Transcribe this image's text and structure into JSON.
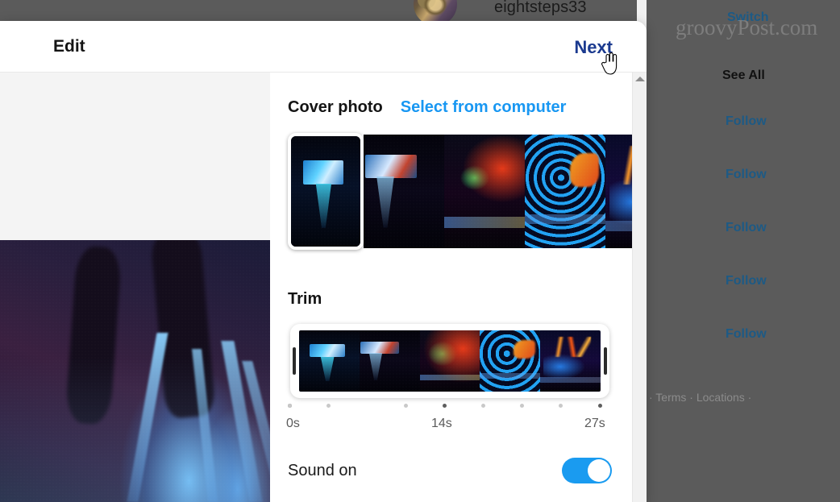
{
  "backdrop": {
    "username": "eightsteps33",
    "switch_label": "Switch",
    "watermark": "groovyPost.com",
    "see_all_label": "See All",
    "follow_labels": [
      "Follow",
      "Follow",
      "Follow",
      "Follow",
      "Follow"
    ],
    "footer_text": "· Terms · Locations ·",
    "dim_color": "#5b5b5b",
    "link_color": "#1d5a85"
  },
  "modal": {
    "title": "Edit",
    "next_label": "Next",
    "cover": {
      "title": "Cover photo",
      "select_link": "Select from computer",
      "selected_index": 0,
      "frames": [
        {
          "name": "frame-stage-screen-laser"
        },
        {
          "name": "frame-stage-screen-red"
        },
        {
          "name": "frame-red-backdrop-green-laser"
        },
        {
          "name": "frame-blue-rings"
        },
        {
          "name": "frame-orange-neon"
        }
      ]
    },
    "trim": {
      "title": "Trim",
      "start_label": "0s",
      "mid_label": "14s",
      "end_label": "27s",
      "tick_count": 9,
      "major_ticks": [
        0,
        4,
        8
      ],
      "handle_left_name": "trim-handle-left",
      "handle_right_name": "trim-handle-right"
    },
    "sound": {
      "label": "Sound on",
      "enabled": true,
      "accent_color": "#1a9bf0"
    },
    "link_color": "#1897f2",
    "next_color": "#1b3a8f"
  },
  "preview": {
    "name": "video-preview",
    "description": "concert stage with blue light beams"
  }
}
